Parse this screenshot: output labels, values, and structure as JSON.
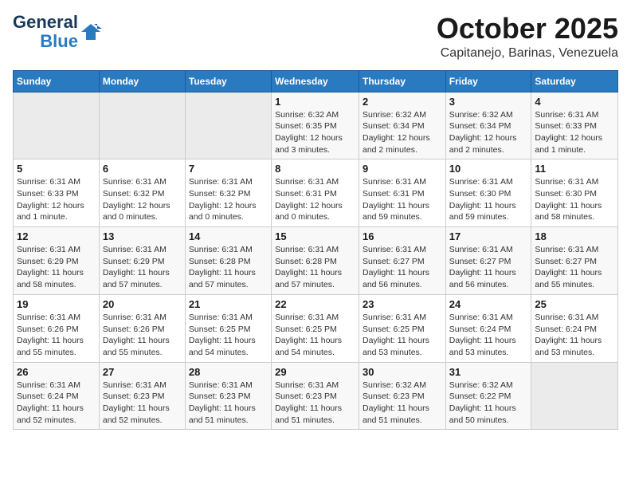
{
  "header": {
    "logo_general": "General",
    "logo_blue": "Blue",
    "month_title": "October 2025",
    "location": "Capitanejo, Barinas, Venezuela"
  },
  "weekdays": [
    "Sunday",
    "Monday",
    "Tuesday",
    "Wednesday",
    "Thursday",
    "Friday",
    "Saturday"
  ],
  "weeks": [
    [
      {
        "day": "",
        "info": ""
      },
      {
        "day": "",
        "info": ""
      },
      {
        "day": "",
        "info": ""
      },
      {
        "day": "1",
        "info": "Sunrise: 6:32 AM\nSunset: 6:35 PM\nDaylight: 12 hours and 3 minutes."
      },
      {
        "day": "2",
        "info": "Sunrise: 6:32 AM\nSunset: 6:34 PM\nDaylight: 12 hours and 2 minutes."
      },
      {
        "day": "3",
        "info": "Sunrise: 6:32 AM\nSunset: 6:34 PM\nDaylight: 12 hours and 2 minutes."
      },
      {
        "day": "4",
        "info": "Sunrise: 6:31 AM\nSunset: 6:33 PM\nDaylight: 12 hours and 1 minute."
      }
    ],
    [
      {
        "day": "5",
        "info": "Sunrise: 6:31 AM\nSunset: 6:33 PM\nDaylight: 12 hours and 1 minute."
      },
      {
        "day": "6",
        "info": "Sunrise: 6:31 AM\nSunset: 6:32 PM\nDaylight: 12 hours and 0 minutes."
      },
      {
        "day": "7",
        "info": "Sunrise: 6:31 AM\nSunset: 6:32 PM\nDaylight: 12 hours and 0 minutes."
      },
      {
        "day": "8",
        "info": "Sunrise: 6:31 AM\nSunset: 6:31 PM\nDaylight: 12 hours and 0 minutes."
      },
      {
        "day": "9",
        "info": "Sunrise: 6:31 AM\nSunset: 6:31 PM\nDaylight: 11 hours and 59 minutes."
      },
      {
        "day": "10",
        "info": "Sunrise: 6:31 AM\nSunset: 6:30 PM\nDaylight: 11 hours and 59 minutes."
      },
      {
        "day": "11",
        "info": "Sunrise: 6:31 AM\nSunset: 6:30 PM\nDaylight: 11 hours and 58 minutes."
      }
    ],
    [
      {
        "day": "12",
        "info": "Sunrise: 6:31 AM\nSunset: 6:29 PM\nDaylight: 11 hours and 58 minutes."
      },
      {
        "day": "13",
        "info": "Sunrise: 6:31 AM\nSunset: 6:29 PM\nDaylight: 11 hours and 57 minutes."
      },
      {
        "day": "14",
        "info": "Sunrise: 6:31 AM\nSunset: 6:28 PM\nDaylight: 11 hours and 57 minutes."
      },
      {
        "day": "15",
        "info": "Sunrise: 6:31 AM\nSunset: 6:28 PM\nDaylight: 11 hours and 57 minutes."
      },
      {
        "day": "16",
        "info": "Sunrise: 6:31 AM\nSunset: 6:27 PM\nDaylight: 11 hours and 56 minutes."
      },
      {
        "day": "17",
        "info": "Sunrise: 6:31 AM\nSunset: 6:27 PM\nDaylight: 11 hours and 56 minutes."
      },
      {
        "day": "18",
        "info": "Sunrise: 6:31 AM\nSunset: 6:27 PM\nDaylight: 11 hours and 55 minutes."
      }
    ],
    [
      {
        "day": "19",
        "info": "Sunrise: 6:31 AM\nSunset: 6:26 PM\nDaylight: 11 hours and 55 minutes."
      },
      {
        "day": "20",
        "info": "Sunrise: 6:31 AM\nSunset: 6:26 PM\nDaylight: 11 hours and 55 minutes."
      },
      {
        "day": "21",
        "info": "Sunrise: 6:31 AM\nSunset: 6:25 PM\nDaylight: 11 hours and 54 minutes."
      },
      {
        "day": "22",
        "info": "Sunrise: 6:31 AM\nSunset: 6:25 PM\nDaylight: 11 hours and 54 minutes."
      },
      {
        "day": "23",
        "info": "Sunrise: 6:31 AM\nSunset: 6:25 PM\nDaylight: 11 hours and 53 minutes."
      },
      {
        "day": "24",
        "info": "Sunrise: 6:31 AM\nSunset: 6:24 PM\nDaylight: 11 hours and 53 minutes."
      },
      {
        "day": "25",
        "info": "Sunrise: 6:31 AM\nSunset: 6:24 PM\nDaylight: 11 hours and 53 minutes."
      }
    ],
    [
      {
        "day": "26",
        "info": "Sunrise: 6:31 AM\nSunset: 6:24 PM\nDaylight: 11 hours and 52 minutes."
      },
      {
        "day": "27",
        "info": "Sunrise: 6:31 AM\nSunset: 6:23 PM\nDaylight: 11 hours and 52 minutes."
      },
      {
        "day": "28",
        "info": "Sunrise: 6:31 AM\nSunset: 6:23 PM\nDaylight: 11 hours and 51 minutes."
      },
      {
        "day": "29",
        "info": "Sunrise: 6:31 AM\nSunset: 6:23 PM\nDaylight: 11 hours and 51 minutes."
      },
      {
        "day": "30",
        "info": "Sunrise: 6:32 AM\nSunset: 6:23 PM\nDaylight: 11 hours and 51 minutes."
      },
      {
        "day": "31",
        "info": "Sunrise: 6:32 AM\nSunset: 6:22 PM\nDaylight: 11 hours and 50 minutes."
      },
      {
        "day": "",
        "info": ""
      }
    ]
  ]
}
